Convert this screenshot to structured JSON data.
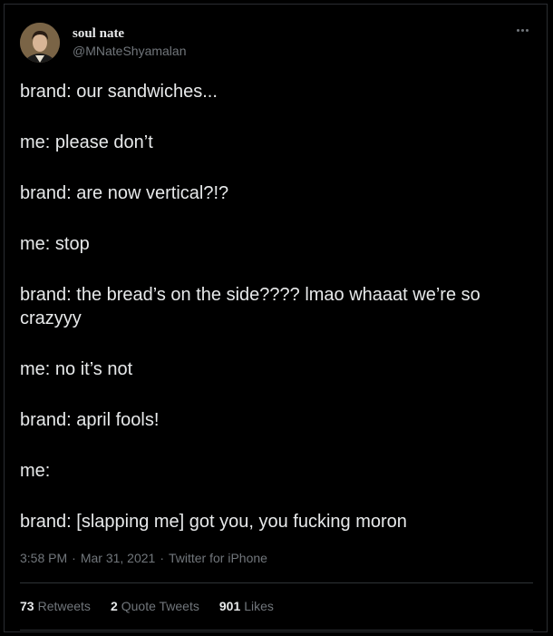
{
  "author": {
    "display_name": "soul nate",
    "handle": "@MNateShyamalan",
    "avatar_icon": "portrait-avatar"
  },
  "tweet": {
    "lines": [
      "brand: our sandwiches...",
      "me: please don’t",
      "brand: are now vertical?!?",
      "me: stop",
      "brand: the bread’s on the side???? lmao whaaat we’re so crazyyy",
      "me: no it’s not",
      "brand: april fools!",
      "me:",
      "brand: [slapping me] got you, you fucking moron"
    ]
  },
  "meta": {
    "time": "3:58 PM",
    "separator": "·",
    "date": "Mar 31, 2021",
    "source": "Twitter for iPhone"
  },
  "stats": {
    "retweets_count": "73",
    "retweets_label": "Retweets",
    "quotes_count": "2",
    "quotes_label": "Quote Tweets",
    "likes_count": "901",
    "likes_label": "Likes"
  },
  "colors": {
    "background": "#000000",
    "primary_text": "#e7e9ea",
    "secondary_text": "#71767b",
    "divider": "#2f3336"
  }
}
